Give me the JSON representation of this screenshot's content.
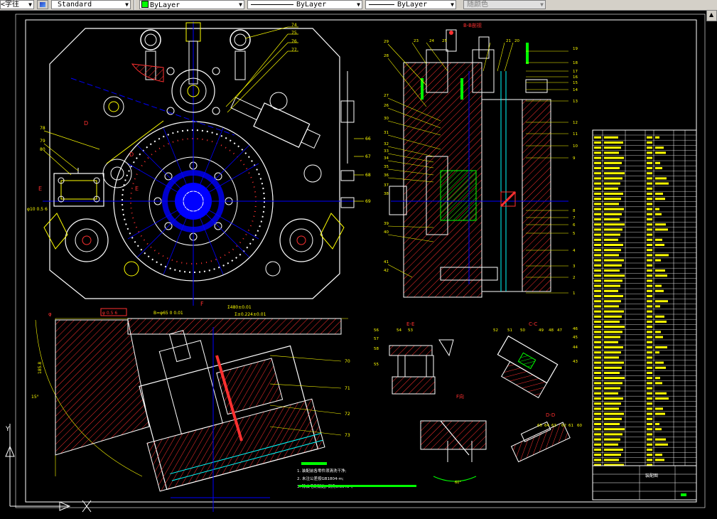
{
  "toolbar": {
    "linetype_scale_partial": "<字往",
    "text_style": "Standard",
    "layer_color": "ByLayer",
    "linetype": "ByLayer",
    "lineweight": "ByLayer",
    "plot_style": "随颜色",
    "icons": [
      "dropdown-arrow",
      "text-style-icon",
      "scroll-up-arrow"
    ]
  },
  "drawing": {
    "section_labels": {
      "b_view": "B-B剖视",
      "e_e": "E-E",
      "c_c": "C-C",
      "d_d": "D-D",
      "f_view": "F向",
      "f_arrow": "F",
      "d_mark_a": "D",
      "d_mark_b": "D",
      "e_mark_a": "E",
      "e_mark_b": "E"
    },
    "dimensions": {
      "ref": "φ10 0.5 6",
      "b_dim": "B=φ65 0 0.01",
      "overall": "Σ480±0.01",
      "sub": "Σ±0.224±0.01",
      "vertical": "185.8",
      "angle": "15°",
      "small": "432",
      "bottom_angle": "60°"
    },
    "balloons_top_right": [
      "74",
      "75",
      "76",
      "77"
    ],
    "balloons_left": [
      "78",
      "79",
      "80"
    ],
    "balloons_mid": [
      "66",
      "67",
      "68",
      "69"
    ],
    "balloons_section": [
      "23",
      "24",
      "25",
      "21",
      "20",
      "19",
      "18",
      "17",
      "16",
      "15",
      "14",
      "13",
      "12",
      "11",
      "10",
      "9",
      "8",
      "7",
      "6",
      "5",
      "4",
      "3",
      "2",
      "1",
      "29",
      "28",
      "27",
      "26",
      "30",
      "31",
      "32",
      "33",
      "34",
      "35",
      "36",
      "37",
      "38",
      "39",
      "40",
      "41",
      "42"
    ],
    "balloons_bottom": [
      "70",
      "71",
      "72",
      "73"
    ],
    "balloons_ee": [
      "56",
      "54",
      "53",
      "57",
      "58",
      "55"
    ],
    "balloons_cc": [
      "52",
      "51",
      "50",
      "49",
      "48",
      "47",
      "46",
      "45",
      "44",
      "43"
    ],
    "balloons_dd": [
      "65",
      "64",
      "63",
      "62",
      "61",
      "60"
    ],
    "notes": {
      "title": "技术要求",
      "line1": "1. 装配前各零件须清洗干净;",
      "line2": "2. 未注公差按GB1804-m;",
      "line3": "3. 除去毛刺锐边, 倒角0.5x45°。"
    },
    "title_block": {
      "name": "装配图"
    }
  },
  "colors": {
    "background": "#000000",
    "border": "#ffffff",
    "hatch": "#ff3030",
    "blue": "#0000ff",
    "yellow": "#ffff00",
    "cyan": "#00ffff",
    "green": "#00ff00",
    "magenta": "#ff00ff",
    "white": "#ffffff",
    "toolbar": "#d4d0c8"
  }
}
